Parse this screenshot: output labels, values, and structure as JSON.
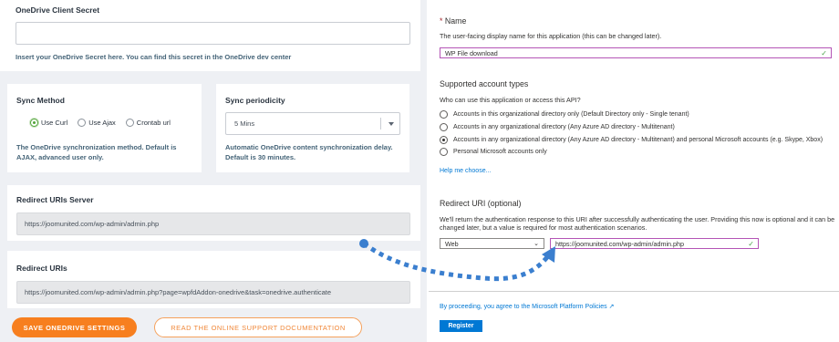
{
  "settings": {
    "secret": {
      "label": "OneDrive Client Secret",
      "value": "",
      "hint": "Insert your OneDrive Secret here. You can find this secret in the OneDrive dev center"
    },
    "sync_method": {
      "label": "Sync Method",
      "options": [
        "Use Curl",
        "Use Ajax",
        "Crontab url"
      ],
      "selected": "Use Curl",
      "hint_line1": "The OneDrive synchronization method. Default is",
      "hint_line2": "AJAX, advanced user only."
    },
    "sync_periodicity": {
      "label": "Sync periodicity",
      "value": "5 Mins",
      "hint_line1": "Automatic OneDrive content synchronization delay.",
      "hint_line2": "Default is 30 minutes."
    },
    "redirect_server": {
      "label": "Redirect URIs Server",
      "value": "https://joomunited.com/wp-admin/admin.php"
    },
    "redirect_uris": {
      "label": "Redirect URIs",
      "value": "https://joomunited.com/wp-admin/admin.php?page=wpfdAddon-onedrive&task=onedrive.authenticate"
    },
    "save_button": "SAVE ONEDRIVE SETTINGS",
    "docs_button": "READ THE ONLINE SUPPORT DOCUMENTATION"
  },
  "azure": {
    "name": {
      "required_mark": "*",
      "label": "Name",
      "description": "The user-facing display name for this application (this can be changed later).",
      "value": "WP File download"
    },
    "account_types": {
      "heading": "Supported account types",
      "question": "Who can use this application or access this API?",
      "options": [
        "Accounts in this organizational directory only (Default Directory only - Single tenant)",
        "Accounts in any organizational directory (Any Azure AD directory - Multitenant)",
        "Accounts in any organizational directory (Any Azure AD directory - Multitenant) and personal Microsoft accounts (e.g. Skype, Xbox)",
        "Personal Microsoft accounts only"
      ],
      "selected_index": 2,
      "help_link": "Help me choose..."
    },
    "redirect": {
      "heading": "Redirect URI (optional)",
      "description_line1": "We'll return the authentication response to this URI after successfully authenticating the user. Providing this now is optional and it can be",
      "description_line2": "changed later, but a value is required for most authentication scenarios.",
      "platform": "Web",
      "uri": "https://joomunited.com/wp-admin/admin.php"
    },
    "policy_text": "By proceeding, you agree to the Microsoft Platform Policies",
    "register_button": "Register"
  },
  "colors": {
    "orange": "#f77f1f",
    "azure_blue": "#0078d4",
    "arrow_blue": "#3b7fcf",
    "radio_green": "#52a43a"
  },
  "icons": {
    "check": "check-icon",
    "caret": "chevron-down-icon",
    "external": "external-link-icon"
  }
}
